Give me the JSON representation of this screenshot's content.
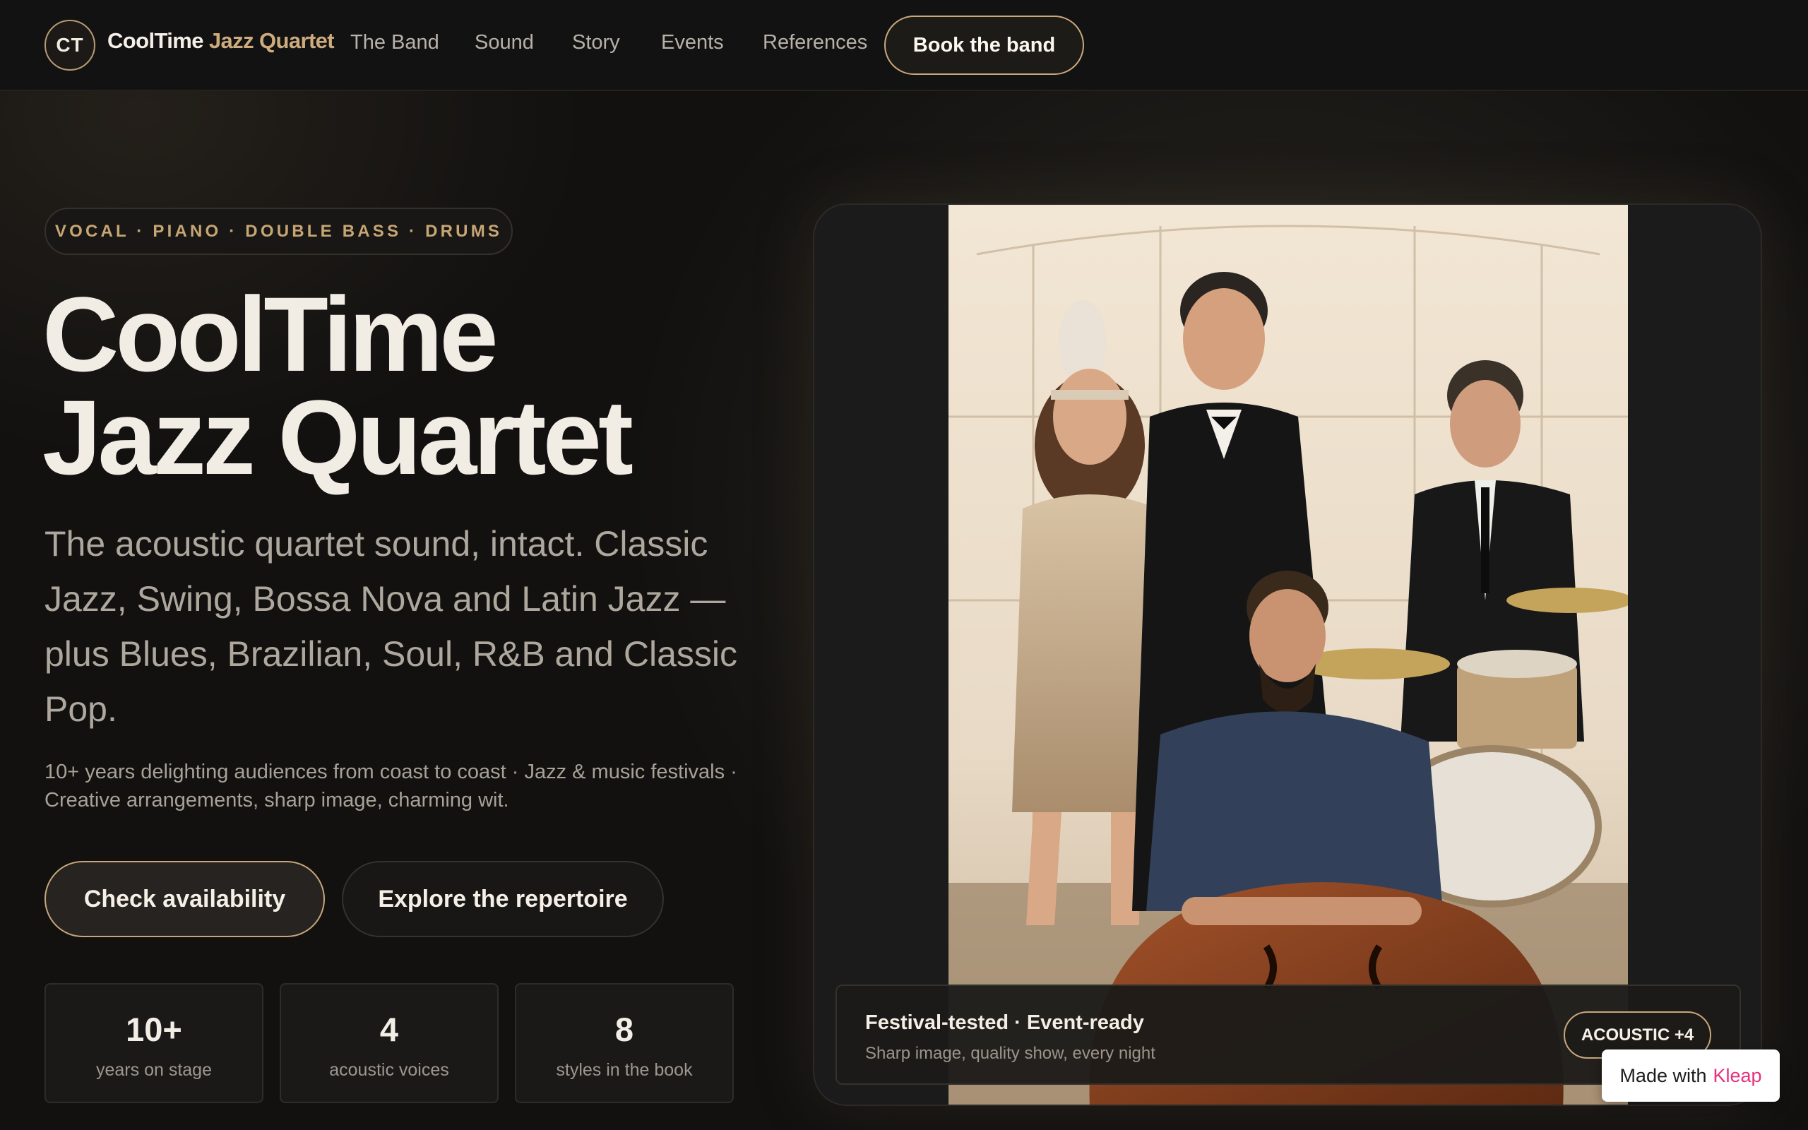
{
  "nav": {
    "logo_initials": "CT",
    "brand_primary": "CoolTime",
    "brand_accent": "Jazz Quartet",
    "links": [
      "The Band",
      "Sound",
      "Story",
      "Events",
      "References"
    ],
    "cta": "Book the band"
  },
  "hero": {
    "instruments_tag": "VOCAL · PIANO · DOUBLE BASS · DRUMS",
    "title_line1": "CoolTime",
    "title_line2": "Jazz Quartet",
    "lead": "The acoustic quartet sound, intact. Classic Jazz, Swing, Bossa Nova and Latin Jazz — plus Blues, Brazilian, Soul, R&B and Classic Pop.",
    "small_copy": "10+ years delighting audiences from coast to coast · Jazz & music festivals · Creative arrangements, sharp image, charming wit.",
    "primary_button": "Check availability",
    "secondary_button": "Explore the repertoire",
    "stats": [
      {
        "value": "10+",
        "label": "years on stage"
      },
      {
        "value": "4",
        "label": "acoustic voices"
      },
      {
        "value": "8",
        "label": "styles in the book"
      }
    ]
  },
  "photo_card": {
    "caption_title": "Festival-tested · Event-ready",
    "caption_sub": "Sharp image, quality show, every night",
    "badge": "ACOUSTIC +4"
  },
  "footer_badge": {
    "prefix": "Made with",
    "brand": "Kleap"
  },
  "colors": {
    "background": "#121110",
    "accent_gold": "#c9a97a",
    "brand_accent_text": "#cdab7d",
    "kleap_pink": "#e5317f"
  }
}
